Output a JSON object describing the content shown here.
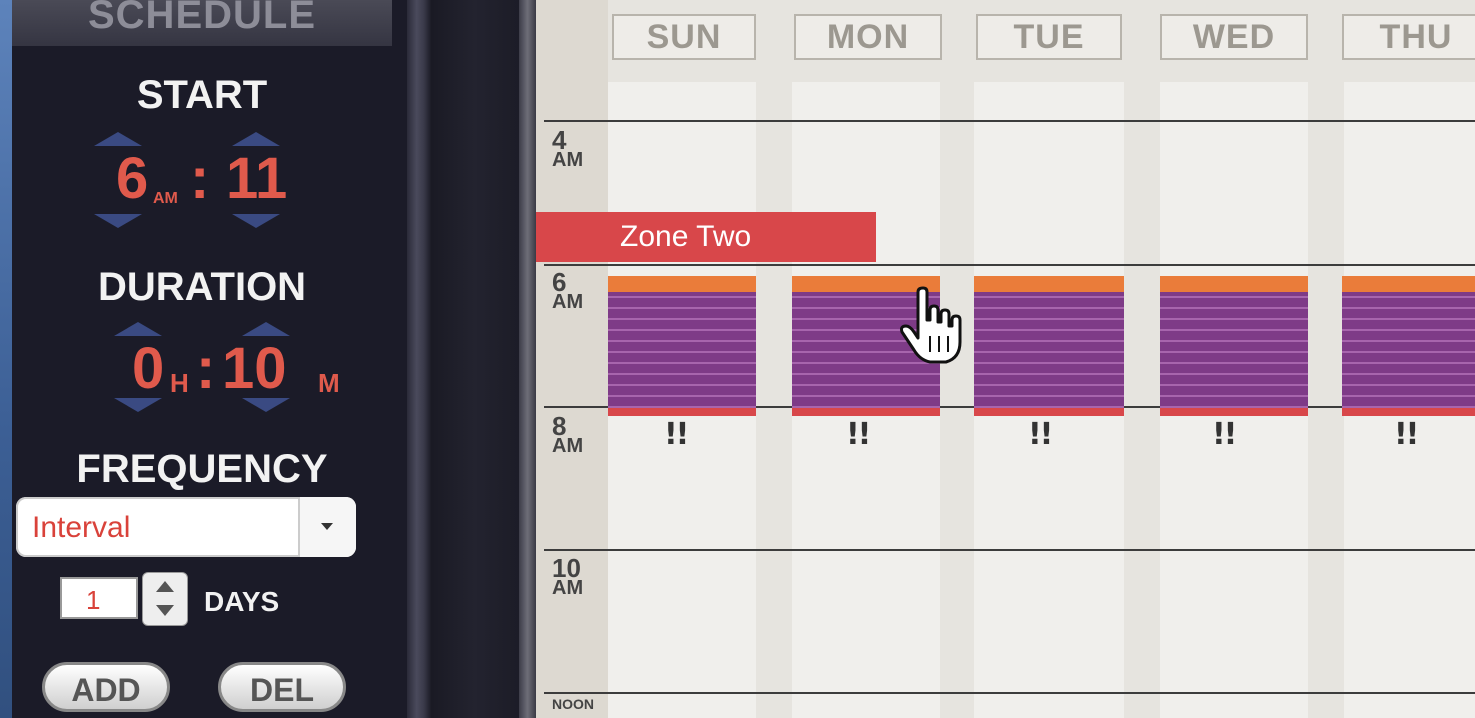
{
  "schedule_panel": {
    "tab_label": "SCHEDULE",
    "start": {
      "label": "START",
      "hour": "6",
      "ampm": "AM",
      "minute": "11"
    },
    "duration": {
      "label": "DURATION",
      "hours": "0",
      "hours_unit": "H",
      "minutes": "10",
      "minutes_unit": "M"
    },
    "frequency": {
      "label": "FREQUENCY",
      "selected": "Interval",
      "interval_value": "1",
      "interval_unit": "DAYS"
    },
    "buttons": {
      "add": "ADD",
      "del": "DEL"
    }
  },
  "calendar": {
    "days": [
      "SUN",
      "MON",
      "TUE",
      "WED",
      "THU"
    ],
    "times": [
      {
        "n": "4",
        "ap": "AM"
      },
      {
        "n": "6",
        "ap": "AM"
      },
      {
        "n": "8",
        "ap": "AM"
      },
      {
        "n": "10",
        "ap": "AM"
      },
      {
        "n": "NOON",
        "ap": ""
      }
    ],
    "zone_label": "Zone Two",
    "event_mark": "!!"
  },
  "colors": {
    "accent_red": "#d8474a",
    "event_purple": "#7e3b87",
    "event_orange": "#ea7c3a",
    "panel_dark": "#1b1b28"
  }
}
